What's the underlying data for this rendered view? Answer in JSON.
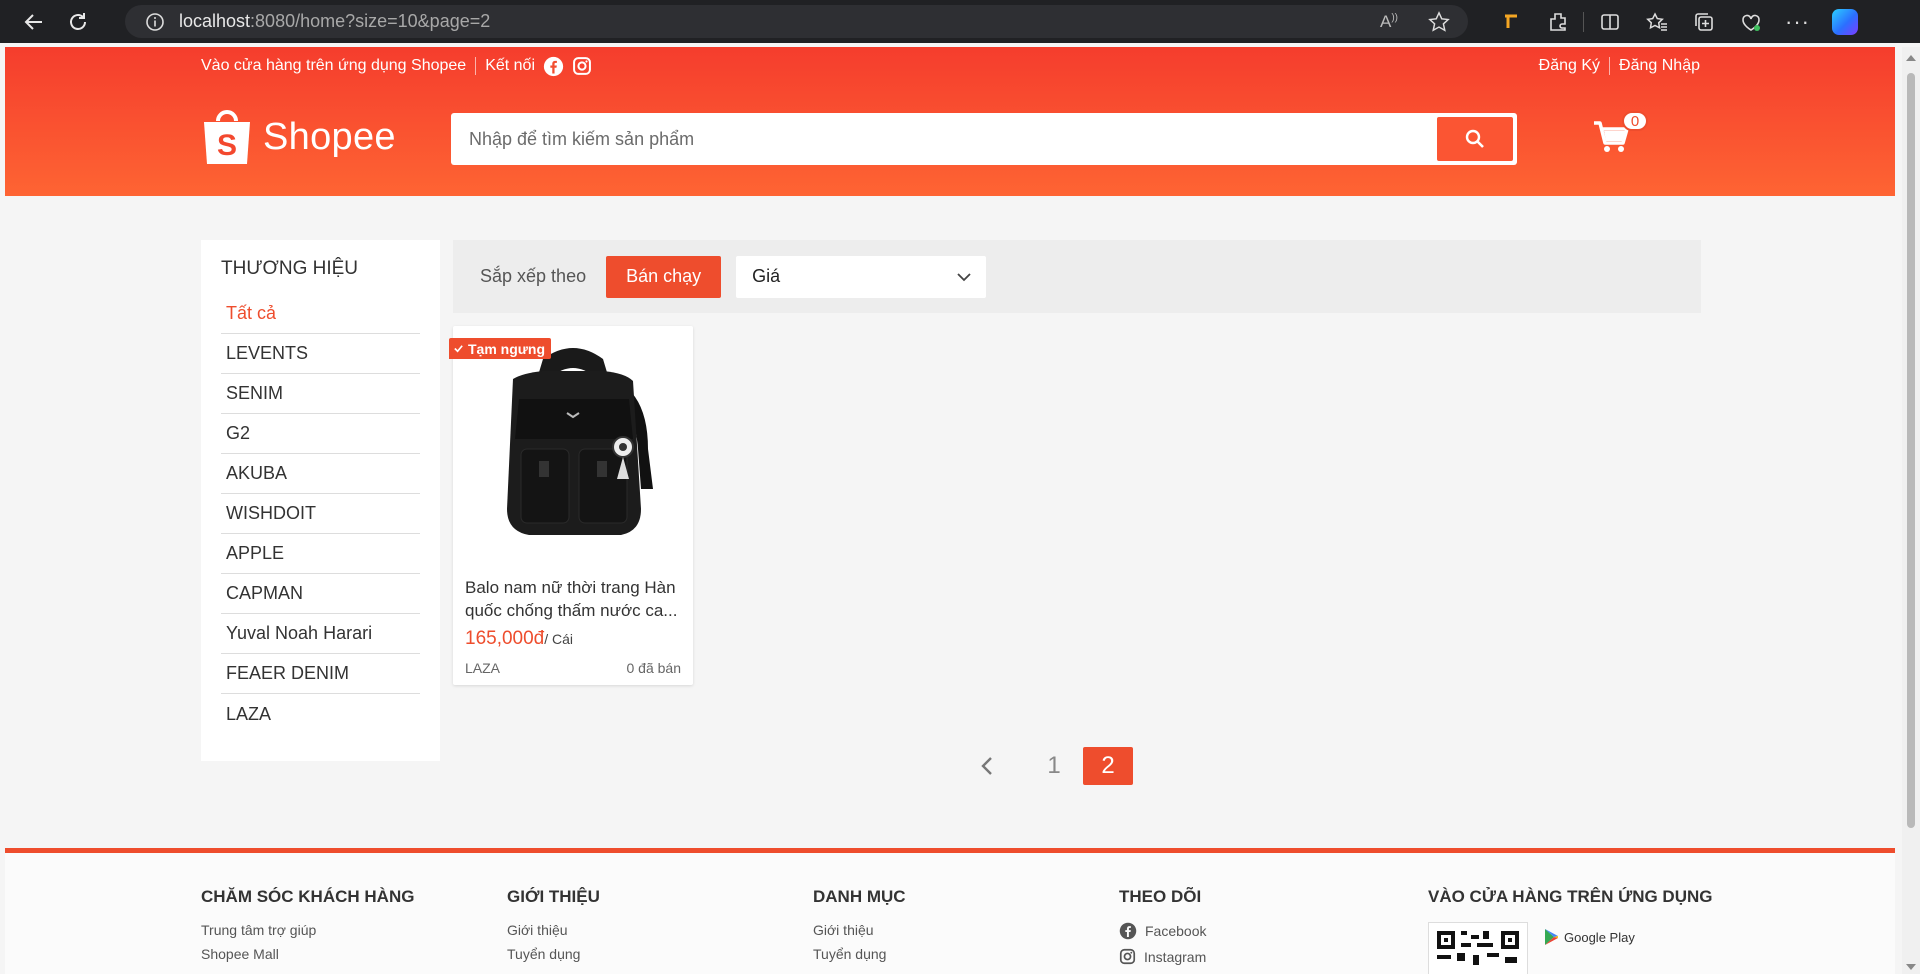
{
  "browser": {
    "url_host": "localhost",
    "url_rest": ":8080/home?size=10&page=2"
  },
  "header": {
    "app_link": "Vào cửa hàng trên ứng dụng Shopee",
    "connect": "Kết nối",
    "register": "Đăng Ký",
    "login": "Đăng Nhập",
    "logo_text": "Shopee",
    "search_placeholder": "Nhập để tìm kiếm sản phẩm",
    "cart_count": "0"
  },
  "sidebar": {
    "title": "THƯƠNG HIỆU",
    "items": [
      {
        "label": "Tất cả",
        "active": true
      },
      {
        "label": "LEVENTS"
      },
      {
        "label": "SENIM"
      },
      {
        "label": "G2"
      },
      {
        "label": "AKUBA"
      },
      {
        "label": "WISHDOIT"
      },
      {
        "label": "APPLE"
      },
      {
        "label": "CAPMAN"
      },
      {
        "label": "Yuval Noah Harari"
      },
      {
        "label": "FEAER DENIM"
      },
      {
        "label": "LAZA"
      }
    ]
  },
  "sort": {
    "label": "Sắp xếp theo",
    "best_selling": "Bán chạy",
    "price_select": "Giá"
  },
  "product": {
    "badge": "Tạm ngưng",
    "name": "Balo nam nữ thời trang Hàn quốc chống thấm nước ca...",
    "price": "165,000đ",
    "unit": "/ Cái",
    "brand": "LAZA",
    "sold": "0 đã bán"
  },
  "pagination": {
    "pages": [
      "1",
      "2"
    ],
    "current": "2"
  },
  "footer": {
    "col1": {
      "title": "CHĂM SÓC KHÁCH HÀNG",
      "links": [
        "Trung tâm trợ giúp",
        "Shopee Mall"
      ]
    },
    "col2": {
      "title": "GIỚI THIỆU",
      "links": [
        "Giới thiệu",
        "Tuyển dụng"
      ]
    },
    "col3": {
      "title": "DANH MỤC",
      "links": [
        "Giới thiệu",
        "Tuyển dụng"
      ]
    },
    "col4": {
      "title": "THEO DÕI",
      "links": [
        "Facebook",
        "Instagram"
      ]
    },
    "col5": {
      "title": "VÀO CỬA HÀNG TRÊN ỨNG DỤNG",
      "google_play": "Google Play"
    }
  },
  "colors": {
    "brand": "#ee4d2d",
    "header_top": "#f53d2d",
    "header_bottom": "#fe6433"
  }
}
